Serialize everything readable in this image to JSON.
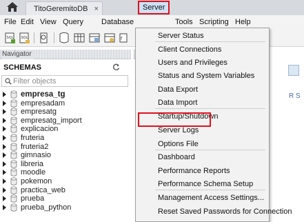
{
  "tab": {
    "label": "TitoGeremitoDB",
    "close": "×"
  },
  "menu": {
    "file": "File",
    "edit": "Edit",
    "view": "View",
    "query": "Query",
    "database": "Database",
    "server": "Server",
    "tools": "Tools",
    "scripting": "Scripting",
    "help": "Help"
  },
  "navigator": {
    "title": "Navigator",
    "schemas_label": "SCHEMAS",
    "filter_placeholder": "Filter objects",
    "schemas": [
      "empresa_tg",
      "empresadam",
      "empresatg",
      "empresatg_import",
      "explicacion",
      "fruteria",
      "fruteria2",
      "gimnasio",
      "libreria",
      "moodle",
      "pokemon",
      "practica_web",
      "prueba",
      "prueba_python"
    ],
    "active_schema": "empresa_tg"
  },
  "server_menu": {
    "items": [
      "Server Status",
      "Client Connections",
      "Users and Privileges",
      "Status and System Variables",
      "Data Export",
      "Data Import",
      "Startup/Shutdown",
      "Server Logs",
      "Options File",
      "Dashboard",
      "Performance Reports",
      "Performance Schema Setup",
      "Management Access Settings...",
      "Reset Saved Passwords for Connection"
    ],
    "highlighted": "Data Import"
  },
  "right_panel": {
    "partial_text": "R S"
  },
  "colors": {
    "highlight_border": "#e0101c",
    "menu_active_bg": "#cde1f6",
    "menu_bg": "#f2f2f2"
  }
}
